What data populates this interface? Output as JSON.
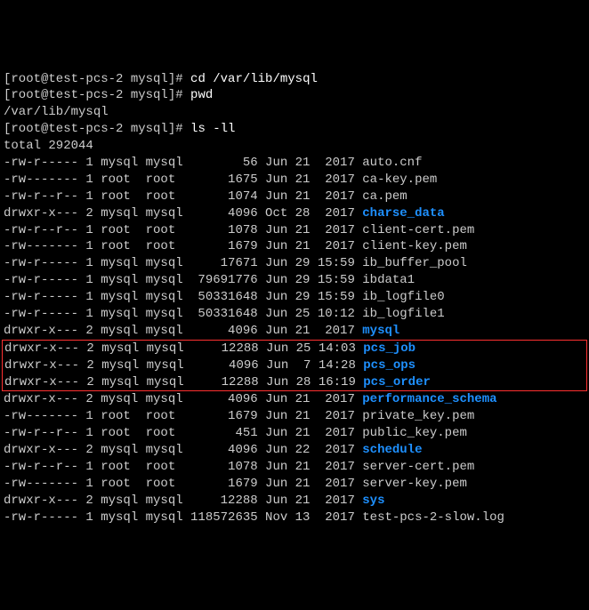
{
  "prompts": [
    {
      "prefix": "[root@test-pcs-2 mysql]# ",
      "command": "cd /var/lib/mysql"
    },
    {
      "prefix": "[root@test-pcs-2 mysql]# ",
      "command": "pwd"
    },
    {
      "prefix": "/var/lib/mysql",
      "command": ""
    },
    {
      "prefix": "[root@test-pcs-2 mysql]# ",
      "command": "ls -ll"
    }
  ],
  "total": "total 292044",
  "rows": [
    {
      "perm": "-rw-r-----",
      "ln": "1",
      "u": "mysql",
      "g": "mysql",
      "sz": "       56",
      "mo": "Jun",
      "d": "21",
      "t": " 2017",
      "name": "auto.cnf",
      "dir": false
    },
    {
      "perm": "-rw-------",
      "ln": "1",
      "u": "root ",
      "g": "root ",
      "sz": "     1675",
      "mo": "Jun",
      "d": "21",
      "t": " 2017",
      "name": "ca-key.pem",
      "dir": false
    },
    {
      "perm": "-rw-r--r--",
      "ln": "1",
      "u": "root ",
      "g": "root ",
      "sz": "     1074",
      "mo": "Jun",
      "d": "21",
      "t": " 2017",
      "name": "ca.pem",
      "dir": false
    },
    {
      "perm": "drwxr-x---",
      "ln": "2",
      "u": "mysql",
      "g": "mysql",
      "sz": "     4096",
      "mo": "Oct",
      "d": "28",
      "t": " 2017",
      "name": "charse_data",
      "dir": true
    },
    {
      "perm": "-rw-r--r--",
      "ln": "1",
      "u": "root ",
      "g": "root ",
      "sz": "     1078",
      "mo": "Jun",
      "d": "21",
      "t": " 2017",
      "name": "client-cert.pem",
      "dir": false
    },
    {
      "perm": "-rw-------",
      "ln": "1",
      "u": "root ",
      "g": "root ",
      "sz": "     1679",
      "mo": "Jun",
      "d": "21",
      "t": " 2017",
      "name": "client-key.pem",
      "dir": false
    },
    {
      "perm": "-rw-r-----",
      "ln": "1",
      "u": "mysql",
      "g": "mysql",
      "sz": "    17671",
      "mo": "Jun",
      "d": "29",
      "t": "15:59",
      "name": "ib_buffer_pool",
      "dir": false
    },
    {
      "perm": "-rw-r-----",
      "ln": "1",
      "u": "mysql",
      "g": "mysql",
      "sz": " 79691776",
      "mo": "Jun",
      "d": "29",
      "t": "15:59",
      "name": "ibdata1",
      "dir": false
    },
    {
      "perm": "-rw-r-----",
      "ln": "1",
      "u": "mysql",
      "g": "mysql",
      "sz": " 50331648",
      "mo": "Jun",
      "d": "29",
      "t": "15:59",
      "name": "ib_logfile0",
      "dir": false
    },
    {
      "perm": "-rw-r-----",
      "ln": "1",
      "u": "mysql",
      "g": "mysql",
      "sz": " 50331648",
      "mo": "Jun",
      "d": "25",
      "t": "10:12",
      "name": "ib_logfile1",
      "dir": false
    },
    {
      "perm": "drwxr-x---",
      "ln": "2",
      "u": "mysql",
      "g": "mysql",
      "sz": "     4096",
      "mo": "Jun",
      "d": "21",
      "t": " 2017",
      "name": "mysql",
      "dir": true
    }
  ],
  "highlighted": [
    {
      "perm": "drwxr-x---",
      "ln": "2",
      "u": "mysql",
      "g": "mysql",
      "sz": "    12288",
      "mo": "Jun",
      "d": "25",
      "t": "14:03",
      "name": "pcs_job",
      "dir": true
    },
    {
      "perm": "drwxr-x---",
      "ln": "2",
      "u": "mysql",
      "g": "mysql",
      "sz": "     4096",
      "mo": "Jun",
      "d": " 7",
      "t": "14:28",
      "name": "pcs_ops",
      "dir": true
    },
    {
      "perm": "drwxr-x---",
      "ln": "2",
      "u": "mysql",
      "g": "mysql",
      "sz": "    12288",
      "mo": "Jun",
      "d": "28",
      "t": "16:19",
      "name": "pcs_order",
      "dir": true
    }
  ],
  "rows2": [
    {
      "perm": "drwxr-x---",
      "ln": "2",
      "u": "mysql",
      "g": "mysql",
      "sz": "     4096",
      "mo": "Jun",
      "d": "21",
      "t": " 2017",
      "name": "performance_schema",
      "dir": true
    },
    {
      "perm": "-rw-------",
      "ln": "1",
      "u": "root ",
      "g": "root ",
      "sz": "     1679",
      "mo": "Jun",
      "d": "21",
      "t": " 2017",
      "name": "private_key.pem",
      "dir": false
    },
    {
      "perm": "-rw-r--r--",
      "ln": "1",
      "u": "root ",
      "g": "root ",
      "sz": "      451",
      "mo": "Jun",
      "d": "21",
      "t": " 2017",
      "name": "public_key.pem",
      "dir": false
    },
    {
      "perm": "drwxr-x---",
      "ln": "2",
      "u": "mysql",
      "g": "mysql",
      "sz": "     4096",
      "mo": "Jun",
      "d": "22",
      "t": " 2017",
      "name": "schedule",
      "dir": true
    },
    {
      "perm": "-rw-r--r--",
      "ln": "1",
      "u": "root ",
      "g": "root ",
      "sz": "     1078",
      "mo": "Jun",
      "d": "21",
      "t": " 2017",
      "name": "server-cert.pem",
      "dir": false
    },
    {
      "perm": "-rw-------",
      "ln": "1",
      "u": "root ",
      "g": "root ",
      "sz": "     1679",
      "mo": "Jun",
      "d": "21",
      "t": " 2017",
      "name": "server-key.pem",
      "dir": false
    },
    {
      "perm": "drwxr-x---",
      "ln": "2",
      "u": "mysql",
      "g": "mysql",
      "sz": "    12288",
      "mo": "Jun",
      "d": "21",
      "t": " 2017",
      "name": "sys",
      "dir": true
    },
    {
      "perm": "-rw-r-----",
      "ln": "1",
      "u": "mysql",
      "g": "mysql",
      "sz": "118572635",
      "mo": "Nov",
      "d": "13",
      "t": " 2017",
      "name": "test-pcs-2-slow.log",
      "dir": false
    }
  ]
}
